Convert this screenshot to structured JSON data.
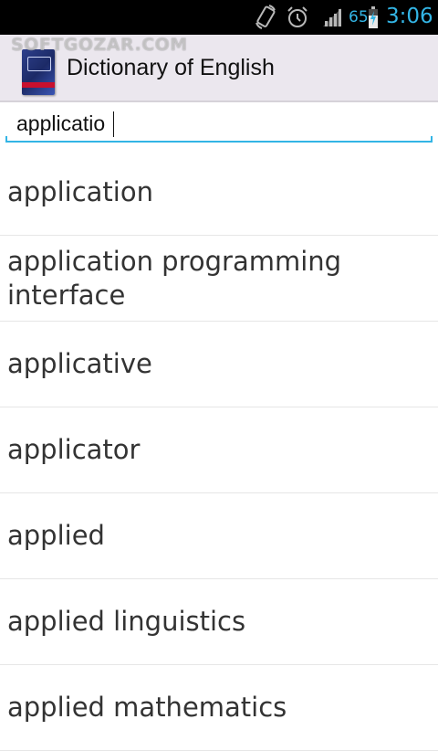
{
  "status_bar": {
    "battery_percent": "65",
    "time": "3:06",
    "accent_color": "#33b5e5",
    "icons": [
      "screen-rotation-icon",
      "alarm-icon",
      "signal-icon",
      "battery-icon"
    ]
  },
  "action_bar": {
    "title": "Dictionary of English",
    "watermark": "SOFTGOZAR.COM",
    "logo_icon": "dictionary-book-icon"
  },
  "search": {
    "value": "applicatio",
    "underline_color": "#33b5e5"
  },
  "results": [
    "application",
    "application programming interface",
    "applicative",
    "applicator",
    "applied",
    "applied linguistics",
    "applied mathematics"
  ]
}
